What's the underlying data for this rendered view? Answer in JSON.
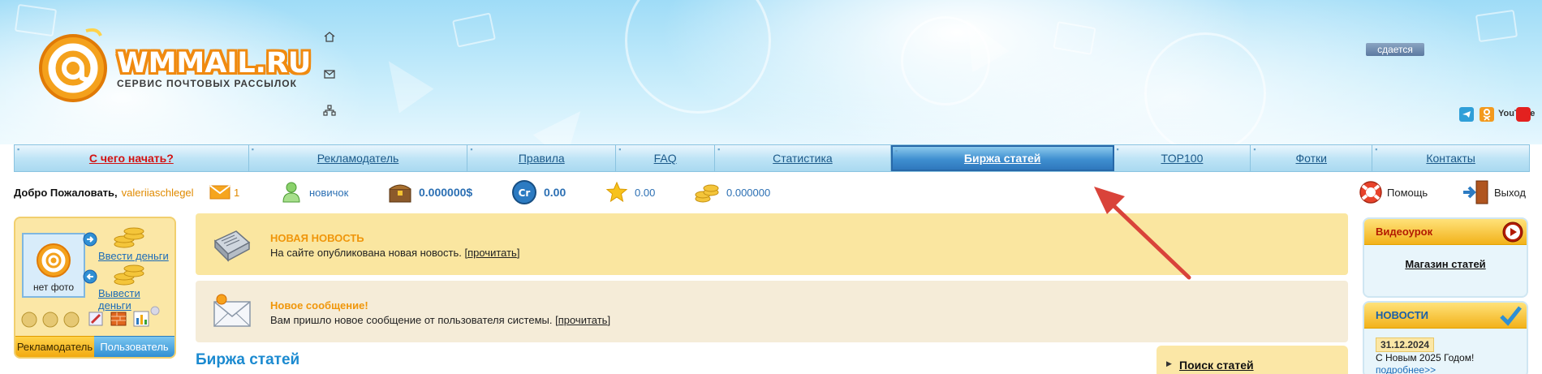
{
  "header": {
    "logo_text": "wmmail.ru",
    "logo_subtitle": "СЕРВИС ПОЧТОВЫХ РАССЫЛОК",
    "rent_badge": "сдается",
    "social": [
      "telegram-icon",
      "odnoklassniki-icon",
      "youtube-icon"
    ],
    "youtube_label": "YouTube"
  },
  "nav": {
    "items": [
      {
        "label": "С чего начать?"
      },
      {
        "label": "Рекламодатель"
      },
      {
        "label": "Правила"
      },
      {
        "label": "FAQ"
      },
      {
        "label": "Статистика"
      },
      {
        "label": "Биржа статей"
      },
      {
        "label": "TOP100"
      },
      {
        "label": "Фотки"
      },
      {
        "label": "Контакты"
      }
    ]
  },
  "userbar": {
    "welcome": "Добро Пожаловать,",
    "username": "valeriiaschlegel",
    "mail_count": "1",
    "rank": "новичок",
    "balance": "0.000000$",
    "credits": "0.00",
    "rating": "0.00",
    "coins": "0.000000",
    "help": "Помощь",
    "logout": "Выход"
  },
  "left_panel": {
    "avatar_label": "нет фото",
    "deposit": "Ввести деньги",
    "withdraw": "Вывести деньги",
    "tab_advertiser": "Рекламодатель",
    "tab_user": "Пользователь"
  },
  "news": [
    {
      "title": "НОВАЯ НОВОСТЬ",
      "text": "На сайте опубликована новая новость. [",
      "link": "прочитать",
      "tail": "]"
    },
    {
      "title": "Новое сообщение!",
      "text": "Вам пришло новое сообщение от пользователя системы. [",
      "link": "прочитать",
      "tail": "]"
    }
  ],
  "main": {
    "heading": "Биржа статей",
    "search_link": "Поиск статей"
  },
  "right_panel": {
    "video_title": "Видеоурок",
    "shop_link": "Магазин статей",
    "news_title": "НОВОСТИ",
    "news_date": "31.12.2024",
    "news_text": "С Новым 2025 Годом!",
    "news_more": "подробнее>>"
  },
  "colors": {
    "accent_blue": "#1b8ad0",
    "logo_orange": "#f08a10",
    "nav_active": "#2f78bd",
    "start_red": "#d31212",
    "annotation_red": "#d9433a"
  }
}
